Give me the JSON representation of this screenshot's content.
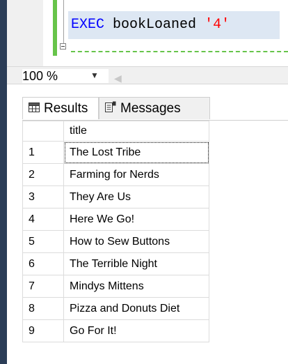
{
  "editor": {
    "code_keyword": "EXEC",
    "code_procedure": "bookLoaned",
    "code_arg": "'4'"
  },
  "zoom": {
    "value": "100 %"
  },
  "tabs": {
    "results": "Results",
    "messages": "Messages"
  },
  "grid": {
    "header": "title",
    "rows": [
      {
        "n": "1",
        "title": "The Lost Tribe"
      },
      {
        "n": "2",
        "title": "Farming for Nerds"
      },
      {
        "n": "3",
        "title": "They Are Us"
      },
      {
        "n": "4",
        "title": "Here We Go!"
      },
      {
        "n": "5",
        "title": "How to Sew Buttons"
      },
      {
        "n": "6",
        "title": "The Terrible Night"
      },
      {
        "n": "7",
        "title": "Mindys Mittens"
      },
      {
        "n": "8",
        "title": "Pizza and Donuts Diet"
      },
      {
        "n": "9",
        "title": "Go For It!"
      }
    ]
  },
  "colors": {
    "change_bar": "#67c44a",
    "keyword": "#0000ff",
    "string": "#ff0000",
    "left_strip": "#2b3d57"
  },
  "icons": {
    "results_tab": "grid-icon",
    "messages_tab": "messages-icon",
    "zoom_dropdown": "chevron-down-icon",
    "collapse": "collapse-minus-icon"
  }
}
